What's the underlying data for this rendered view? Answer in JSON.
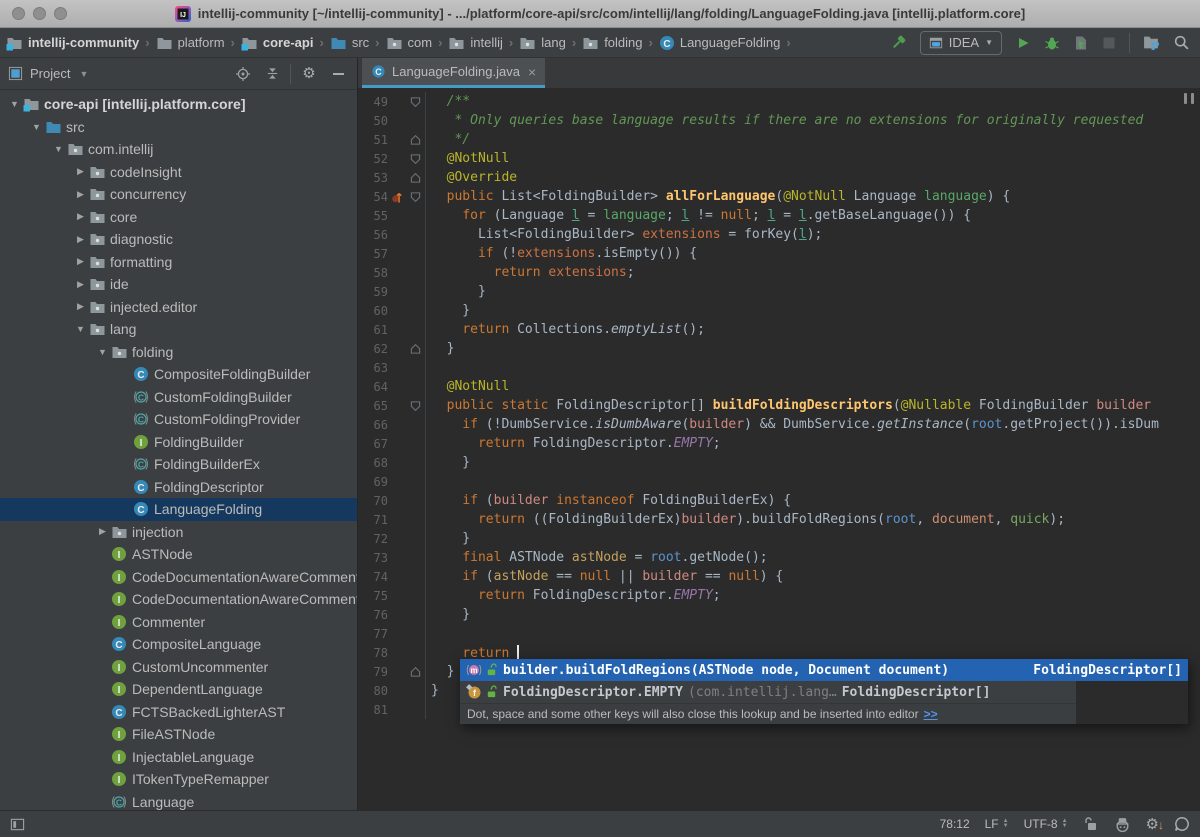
{
  "title_bar": {
    "title": "intellij-community [~/intellij-community] - .../platform/core-api/src/com/intellij/lang/folding/LanguageFolding.java [intellij.platform.core]"
  },
  "nav": {
    "breadcrumbs": [
      {
        "label": "intellij-community",
        "icon": "module",
        "bold": true
      },
      {
        "label": "platform",
        "icon": "folder",
        "bold": false
      },
      {
        "label": "core-api",
        "icon": "module",
        "bold": true
      },
      {
        "label": "src",
        "icon": "source",
        "bold": false
      },
      {
        "label": "com",
        "icon": "package",
        "bold": false
      },
      {
        "label": "intellij",
        "icon": "package",
        "bold": false
      },
      {
        "label": "lang",
        "icon": "package",
        "bold": false
      },
      {
        "label": "folding",
        "icon": "package",
        "bold": false
      },
      {
        "label": "LanguageFolding",
        "icon": "class",
        "bold": false
      }
    ],
    "run_config_label": "IDEA"
  },
  "project_panel": {
    "title": "Project",
    "tree": [
      {
        "label": "core-api [intellij.platform.core]",
        "icon": "module",
        "depth": 0,
        "state": "open",
        "bold": true
      },
      {
        "label": "src",
        "icon": "source",
        "depth": 1,
        "state": "open"
      },
      {
        "label": "com.intellij",
        "icon": "package",
        "depth": 2,
        "state": "open"
      },
      {
        "label": "codeInsight",
        "icon": "package",
        "depth": 3,
        "state": "closed"
      },
      {
        "label": "concurrency",
        "icon": "package",
        "depth": 3,
        "state": "closed"
      },
      {
        "label": "core",
        "icon": "package",
        "depth": 3,
        "state": "closed"
      },
      {
        "label": "diagnostic",
        "icon": "package",
        "depth": 3,
        "state": "closed"
      },
      {
        "label": "formatting",
        "icon": "package",
        "depth": 3,
        "state": "closed"
      },
      {
        "label": "ide",
        "icon": "package",
        "depth": 3,
        "state": "closed"
      },
      {
        "label": "injected.editor",
        "icon": "package",
        "depth": 3,
        "state": "closed"
      },
      {
        "label": "lang",
        "icon": "package",
        "depth": 3,
        "state": "open"
      },
      {
        "label": "folding",
        "icon": "package",
        "depth": 4,
        "state": "open"
      },
      {
        "label": "CompositeFoldingBuilder",
        "icon": "class",
        "depth": 5
      },
      {
        "label": "CustomFoldingBuilder",
        "icon": "abstract",
        "depth": 5
      },
      {
        "label": "CustomFoldingProvider",
        "icon": "abstract",
        "depth": 5
      },
      {
        "label": "FoldingBuilder",
        "icon": "interface",
        "depth": 5
      },
      {
        "label": "FoldingBuilderEx",
        "icon": "abstract",
        "depth": 5
      },
      {
        "label": "FoldingDescriptor",
        "icon": "class",
        "depth": 5
      },
      {
        "label": "LanguageFolding",
        "icon": "class",
        "depth": 5,
        "selected": true
      },
      {
        "label": "injection",
        "icon": "package",
        "depth": 4,
        "state": "closed"
      },
      {
        "label": "ASTNode",
        "icon": "interface",
        "depth": 4
      },
      {
        "label": "CodeDocumentationAwareCommenter",
        "icon": "interface",
        "depth": 4
      },
      {
        "label": "CodeDocumentationAwareCommenterEx",
        "icon": "interface",
        "depth": 4
      },
      {
        "label": "Commenter",
        "icon": "interface",
        "depth": 4
      },
      {
        "label": "CompositeLanguage",
        "icon": "class",
        "depth": 4
      },
      {
        "label": "CustomUncommenter",
        "icon": "interface",
        "depth": 4
      },
      {
        "label": "DependentLanguage",
        "icon": "interface",
        "depth": 4
      },
      {
        "label": "FCTSBackedLighterAST",
        "icon": "class",
        "depth": 4
      },
      {
        "label": "FileASTNode",
        "icon": "interface",
        "depth": 4
      },
      {
        "label": "InjectableLanguage",
        "icon": "interface",
        "depth": 4
      },
      {
        "label": "ITokenTypeRemapper",
        "icon": "interface",
        "depth": 4
      },
      {
        "label": "Language",
        "icon": "abstract",
        "depth": 4
      }
    ]
  },
  "editor": {
    "tab": {
      "title": "LanguageFolding.java",
      "close_label": "×"
    },
    "syntax_colors": {
      "keyword": "#CC7832",
      "annotation": "#BBB529",
      "method_declaration": "#FFC66D",
      "comment": "#629755",
      "static_field": "#9876AA",
      "text": "#A9B7C6",
      "line_number": "#606366"
    },
    "lines": [
      {
        "n": 49,
        "fold": "start",
        "tokens": [
          [
            "c",
            "  /**"
          ]
        ]
      },
      {
        "n": 50,
        "tokens": [
          [
            "c",
            "   * Only queries base language results if there are no extensions for originally requested"
          ]
        ]
      },
      {
        "n": 51,
        "fold": "end",
        "tokens": [
          [
            "c",
            "   */"
          ]
        ]
      },
      {
        "n": 52,
        "fold": "start",
        "tokens": [
          [
            "t",
            "  "
          ],
          [
            "a",
            "@NotNull"
          ]
        ]
      },
      {
        "n": 53,
        "fold": "end",
        "tokens": [
          [
            "t",
            "  "
          ],
          [
            "a",
            "@Override"
          ]
        ]
      },
      {
        "n": 54,
        "fold": "start",
        "gutter": "override",
        "tokens": [
          [
            "t",
            "  "
          ],
          [
            "k",
            "public"
          ],
          [
            "t",
            " List<FoldingBuilder> "
          ],
          [
            "d",
            "allForLanguage"
          ],
          [
            "t",
            "("
          ],
          [
            "a",
            "@NotNull"
          ],
          [
            "t",
            " Language "
          ],
          [
            "vLang",
            "language"
          ],
          [
            "t",
            ") {"
          ]
        ]
      },
      {
        "n": 55,
        "tokens": [
          [
            "t",
            "    "
          ],
          [
            "k",
            "for"
          ],
          [
            "t",
            " (Language "
          ],
          [
            "vL",
            "l"
          ],
          [
            "t",
            " = "
          ],
          [
            "vLang",
            "language"
          ],
          [
            "t",
            "; "
          ],
          [
            "vL",
            "l"
          ],
          [
            "t",
            " != "
          ],
          [
            "k",
            "null"
          ],
          [
            "t",
            "; "
          ],
          [
            "vL",
            "l"
          ],
          [
            "t",
            " = "
          ],
          [
            "vL",
            "l"
          ],
          [
            "t",
            ".getBaseLanguage()) {"
          ]
        ]
      },
      {
        "n": 56,
        "tokens": [
          [
            "t",
            "      List<FoldingBuilder> "
          ],
          [
            "vExt",
            "extensions"
          ],
          [
            "t",
            " = forKey("
          ],
          [
            "vL",
            "l"
          ],
          [
            "t",
            ");"
          ]
        ]
      },
      {
        "n": 57,
        "tokens": [
          [
            "t",
            "      "
          ],
          [
            "k",
            "if"
          ],
          [
            "t",
            " (!"
          ],
          [
            "vExt",
            "extensions"
          ],
          [
            "t",
            ".isEmpty()) {"
          ]
        ]
      },
      {
        "n": 58,
        "tokens": [
          [
            "t",
            "        "
          ],
          [
            "k",
            "return"
          ],
          [
            "t",
            " "
          ],
          [
            "vExt",
            "extensions"
          ],
          [
            "t",
            ";"
          ]
        ]
      },
      {
        "n": 59,
        "tokens": [
          [
            "t",
            "      }"
          ]
        ]
      },
      {
        "n": 60,
        "tokens": [
          [
            "t",
            "    }"
          ]
        ]
      },
      {
        "n": 61,
        "tokens": [
          [
            "t",
            "    "
          ],
          [
            "k",
            "return"
          ],
          [
            "t",
            " Collections."
          ],
          [
            "sm",
            "emptyList"
          ],
          [
            "t",
            "();"
          ]
        ]
      },
      {
        "n": 62,
        "fold": "end",
        "tokens": [
          [
            "t",
            "  }"
          ]
        ]
      },
      {
        "n": 63,
        "tokens": []
      },
      {
        "n": 64,
        "tokens": [
          [
            "t",
            "  "
          ],
          [
            "a",
            "@NotNull"
          ]
        ]
      },
      {
        "n": 65,
        "fold": "start",
        "tokens": [
          [
            "t",
            "  "
          ],
          [
            "k",
            "public"
          ],
          [
            "t",
            " "
          ],
          [
            "k",
            "static"
          ],
          [
            "t",
            " FoldingDescriptor[] "
          ],
          [
            "d",
            "buildFoldingDescriptors"
          ],
          [
            "t",
            "("
          ],
          [
            "a",
            "@Nullable"
          ],
          [
            "t",
            " FoldingBuilder "
          ],
          [
            "vB",
            "builder"
          ]
        ]
      },
      {
        "n": 66,
        "tokens": [
          [
            "t",
            "    "
          ],
          [
            "k",
            "if"
          ],
          [
            "t",
            " (!DumbService."
          ],
          [
            "sm",
            "isDumbAware"
          ],
          [
            "t",
            "("
          ],
          [
            "vB",
            "builder"
          ],
          [
            "t",
            ") && DumbService."
          ],
          [
            "sm",
            "getInstance"
          ],
          [
            "t",
            "("
          ],
          [
            "vR",
            "root"
          ],
          [
            "t",
            ".getProject()).isDum"
          ]
        ]
      },
      {
        "n": 67,
        "tokens": [
          [
            "t",
            "      "
          ],
          [
            "k",
            "return"
          ],
          [
            "t",
            " FoldingDescriptor."
          ],
          [
            "sf",
            "EMPTY"
          ],
          [
            "t",
            ";"
          ]
        ]
      },
      {
        "n": 68,
        "tokens": [
          [
            "t",
            "    }"
          ]
        ]
      },
      {
        "n": 69,
        "tokens": []
      },
      {
        "n": 70,
        "tokens": [
          [
            "t",
            "    "
          ],
          [
            "k",
            "if"
          ],
          [
            "t",
            " ("
          ],
          [
            "vB",
            "builder"
          ],
          [
            "t",
            " "
          ],
          [
            "k",
            "instanceof"
          ],
          [
            "t",
            " FoldingBuilderEx) {"
          ]
        ]
      },
      {
        "n": 71,
        "tokens": [
          [
            "t",
            "      "
          ],
          [
            "k",
            "return"
          ],
          [
            "t",
            " ((FoldingBuilderEx)"
          ],
          [
            "vB",
            "builder"
          ],
          [
            "t",
            ").buildFoldRegions("
          ],
          [
            "vR",
            "root"
          ],
          [
            "t",
            ", "
          ],
          [
            "vD",
            "document"
          ],
          [
            "t",
            ", "
          ],
          [
            "vQ",
            "quick"
          ],
          [
            "t",
            ");"
          ]
        ]
      },
      {
        "n": 72,
        "tokens": [
          [
            "t",
            "    }"
          ]
        ]
      },
      {
        "n": 73,
        "tokens": [
          [
            "t",
            "    "
          ],
          [
            "k",
            "final"
          ],
          [
            "t",
            " ASTNode "
          ],
          [
            "vA",
            "astNode"
          ],
          [
            "t",
            " = "
          ],
          [
            "vR",
            "root"
          ],
          [
            "t",
            ".getNode();"
          ]
        ]
      },
      {
        "n": 74,
        "tokens": [
          [
            "t",
            "    "
          ],
          [
            "k",
            "if"
          ],
          [
            "t",
            " ("
          ],
          [
            "vA",
            "astNode"
          ],
          [
            "t",
            " == "
          ],
          [
            "k",
            "null"
          ],
          [
            "t",
            " || "
          ],
          [
            "vB",
            "builder"
          ],
          [
            "t",
            " == "
          ],
          [
            "k",
            "null"
          ],
          [
            "t",
            ") {"
          ]
        ]
      },
      {
        "n": 75,
        "tokens": [
          [
            "t",
            "      "
          ],
          [
            "k",
            "return"
          ],
          [
            "t",
            " FoldingDescriptor."
          ],
          [
            "sf",
            "EMPTY"
          ],
          [
            "t",
            ";"
          ]
        ]
      },
      {
        "n": 76,
        "tokens": [
          [
            "t",
            "    }"
          ]
        ]
      },
      {
        "n": 77,
        "tokens": []
      },
      {
        "n": 78,
        "tokens": [
          [
            "t",
            "    "
          ],
          [
            "k",
            "return"
          ],
          [
            "t",
            " "
          ],
          [
            "caret",
            ""
          ]
        ]
      },
      {
        "n": 79,
        "fold": "end",
        "tokens": [
          [
            "t",
            "  }"
          ]
        ]
      },
      {
        "n": 80,
        "tokens": [
          [
            "t",
            "}"
          ]
        ]
      },
      {
        "n": 81,
        "tokens": []
      }
    ]
  },
  "popup": {
    "items": [
      {
        "selected": true,
        "icon": "method",
        "visibility_icon": "public",
        "text": "builder.buildFoldRegions(ASTNode node, Document document)",
        "type": "FoldingDescriptor[]"
      },
      {
        "selected": false,
        "icon": "field",
        "visibility_icon": "public",
        "text": "FoldingDescriptor.EMPTY",
        "tail": " (com.intellij.lang…",
        "type": "FoldingDescriptor[]"
      }
    ],
    "hint": "Dot, space and some other keys will also close this lookup and be inserted into editor",
    "hint_link": ">>"
  },
  "status_bar": {
    "position": "78:12",
    "line_separator": "LF",
    "encoding": "UTF-8"
  },
  "colors": {
    "panel_bg": "#3C3F41",
    "editor_bg": "#2B2B2B",
    "tree_selection": "#15395E",
    "popup_selection": "#2363B1",
    "tab_underline": "#459AC6",
    "run_green": "#53A653",
    "link_blue": "#5394EC",
    "update_orange": "#E8944A"
  }
}
